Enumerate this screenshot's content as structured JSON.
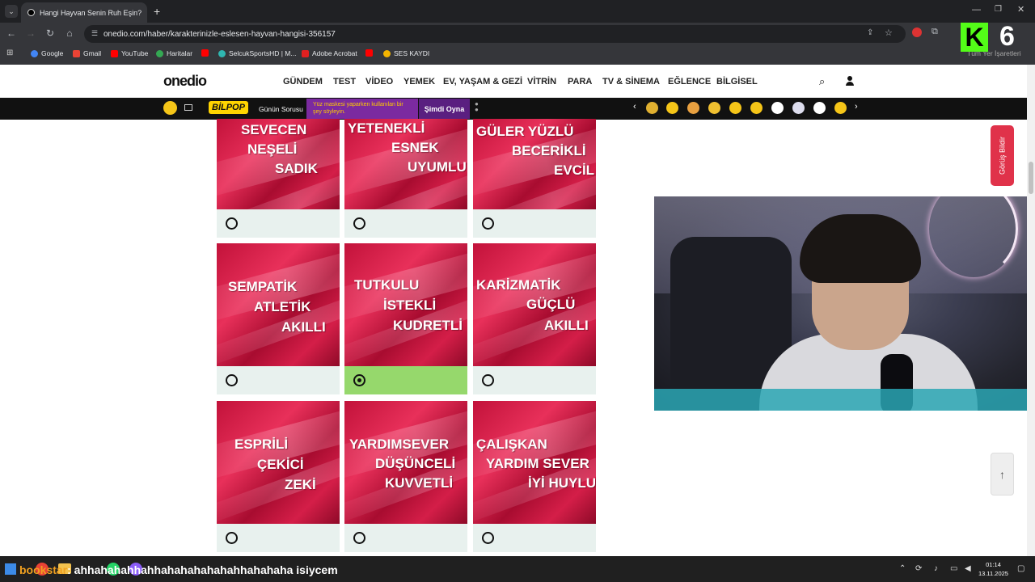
{
  "browser": {
    "tab_title": "Hangi Hayvan Senin Ruh Eşin?",
    "tab_close": "✕",
    "new_tab": "+",
    "url": "onedio.com/haber/karakterinizle-eslesen-hayvan-hangisi-356157",
    "bookmarks": [
      "Google",
      "Gmail",
      "YouTube",
      "Haritalar",
      "SelcukSportsHD | M...",
      "Adobe Acrobat",
      "SES KAYDI"
    ],
    "all_bookmarks": "Tüm Yer İşaretleri"
  },
  "site": {
    "logo": "onedio",
    "nav": [
      "GÜNDEM",
      "TEST",
      "VİDEO",
      "YEMEK",
      "EV, YAŞAM & GEZİ",
      "VİTRİN",
      "PARA",
      "TV & SİNEMA",
      "EĞLENCE",
      "BİLGİSEL"
    ],
    "bilpop": {
      "logo": "BİLPOP",
      "label": "Günün Sorusu",
      "question": "Yüz maskesi yaparken kullanılan bir şey söyleyin.",
      "button": "Şimdi Oyna"
    },
    "feedback": "Görüş Bildir"
  },
  "quiz": {
    "options": [
      {
        "lines": [
          "SEVECEN",
          "NEŞELİ",
          "SADIK"
        ],
        "selected": false
      },
      {
        "lines": [
          "YETENEKLİ",
          "ESNEK",
          "UYUMLU"
        ],
        "selected": false
      },
      {
        "lines": [
          "GÜLER YÜZLÜ",
          "BECERİKLİ",
          "EVCİL"
        ],
        "selected": false
      },
      {
        "lines": [
          "SEMPATİK",
          "ATLETİK",
          "AKILLI"
        ],
        "selected": false
      },
      {
        "lines": [
          "TUTKULU",
          "İSTEKLİ",
          "KUDRETLİ"
        ],
        "selected": true
      },
      {
        "lines": [
          "KARİZMATİK",
          "GÜÇLÜ",
          "AKILLI"
        ],
        "selected": false
      },
      {
        "lines": [
          "ESPRİLİ",
          "ÇEKİCİ",
          "ZEKİ"
        ],
        "selected": false
      },
      {
        "lines": [
          "YARDIMSEVER",
          "DÜŞÜNCELİ",
          "KUVVETLİ"
        ],
        "selected": false
      },
      {
        "lines": [
          "ÇALIŞKAN",
          "YARDIM SEVER",
          "İYİ HUYLU"
        ],
        "selected": false
      }
    ]
  },
  "overlay": {
    "k_logo": "K",
    "k_number": "6",
    "chat_user": "bookstar",
    "chat_message": ": ahhahahahhahhahahahahahahhahahaha isiycem"
  },
  "taskbar": {
    "time": "01:14",
    "date": "13.11.2025"
  },
  "colors": {
    "selected_answer": "#96d86c",
    "answer_bg": "#e8f1ee",
    "card_red": "#c2123a",
    "kick_green": "#53fc18"
  }
}
